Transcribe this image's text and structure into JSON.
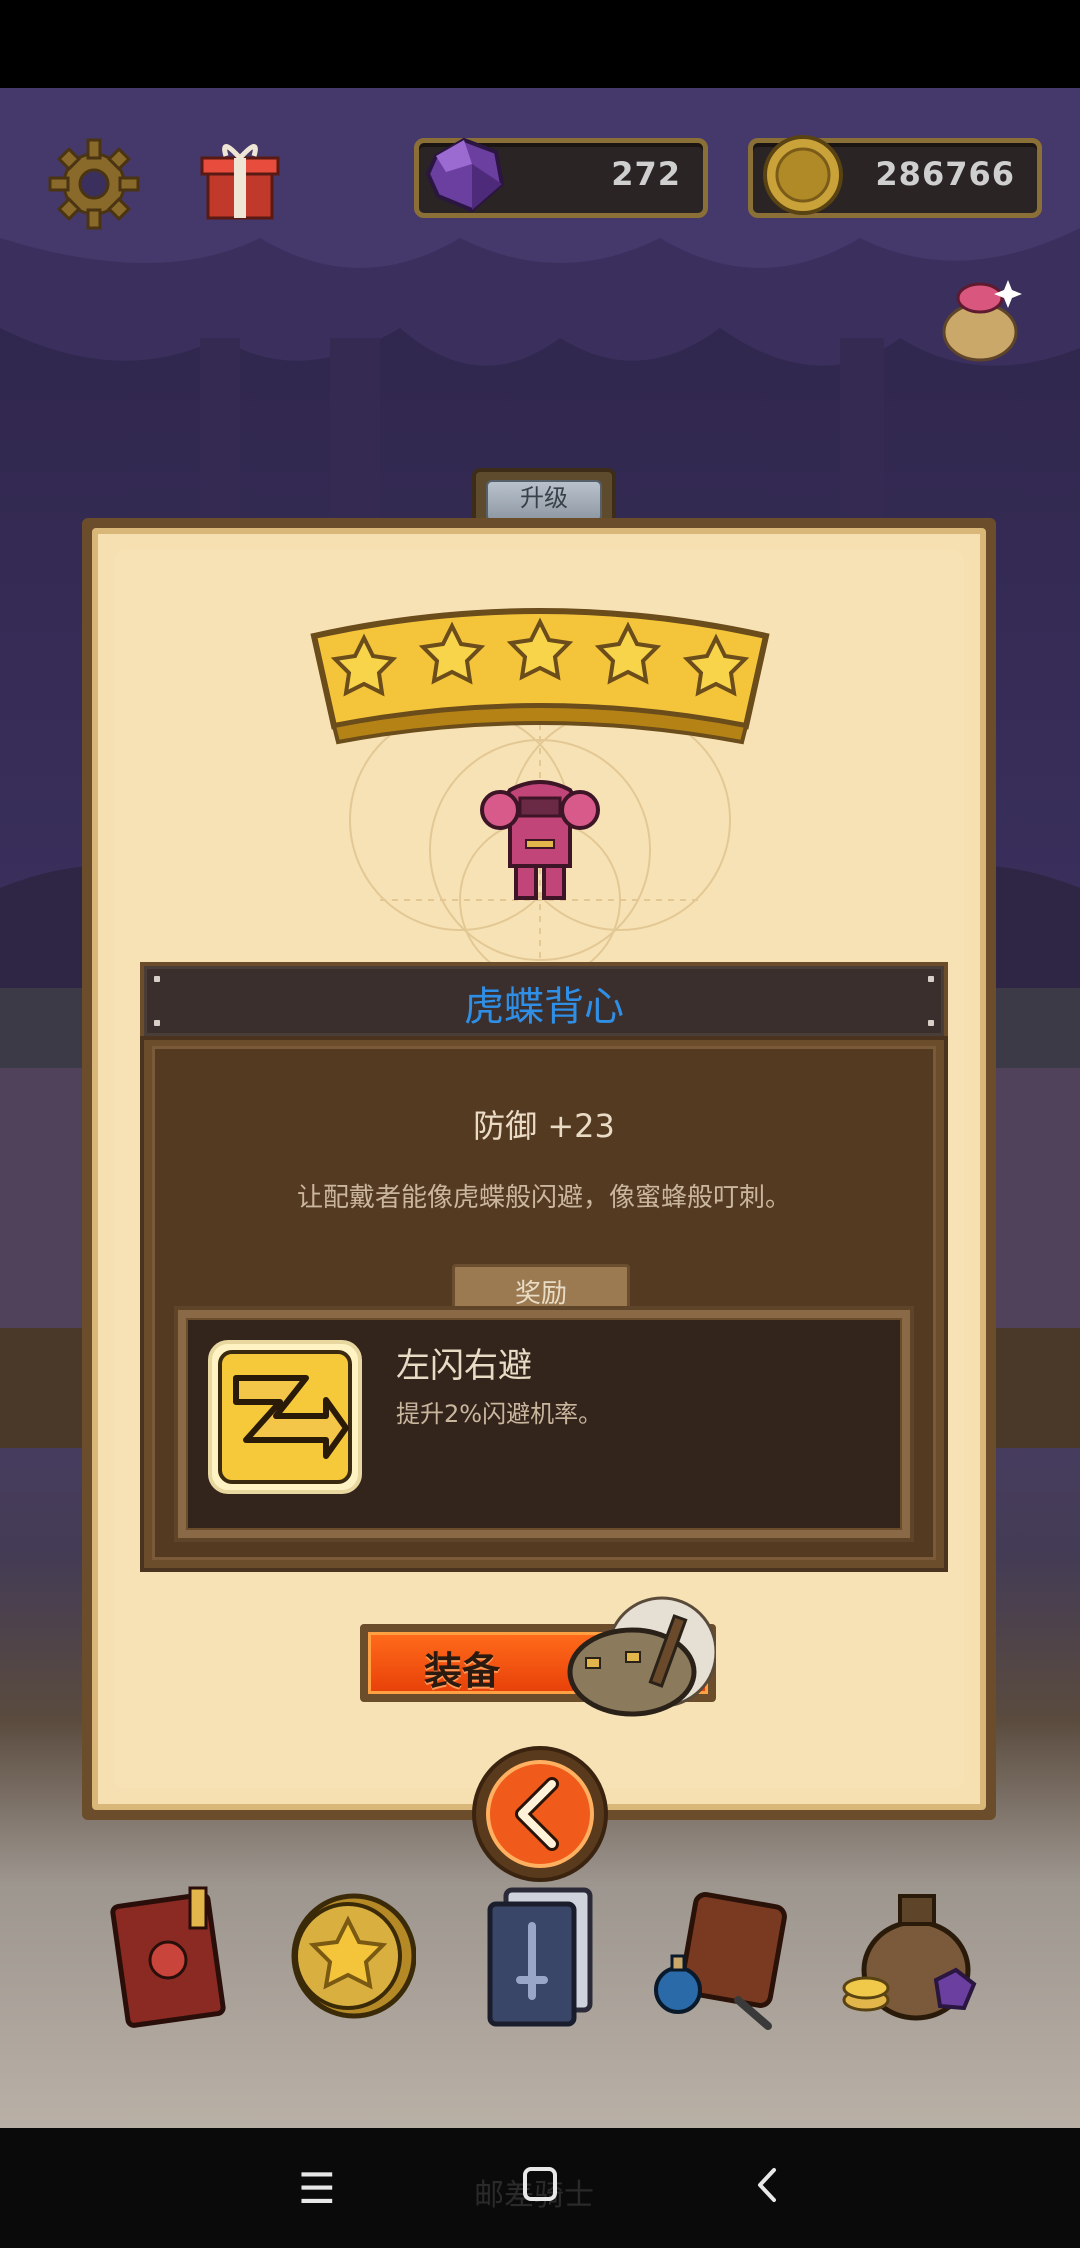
{
  "hud": {
    "gems": "272",
    "gold": "286766"
  },
  "modal": {
    "tab_label": "升级",
    "stars": 5,
    "item_name": "虎蝶背心",
    "stat": "防御 +23",
    "description": "让配戴者能像虎蝶般闪避，像蜜蜂般叮刺。",
    "reward_tab": "奖励",
    "reward": {
      "name": "左闪右避",
      "description": "提升2%闪避机率。"
    },
    "equip_label": "装备"
  },
  "bottom_menu": [
    {
      "name": "skull-book-icon"
    },
    {
      "name": "star-coin-icon"
    },
    {
      "name": "sword-cards-icon"
    },
    {
      "name": "backpack-potion-icon"
    },
    {
      "name": "treasure-sack-icon"
    }
  ],
  "navbar": {
    "app_label": "邮差骑士"
  },
  "colors": {
    "item_name": "#2f8fe6",
    "equip_button": "#ff6a1a",
    "panel": "#f7e2b6"
  }
}
